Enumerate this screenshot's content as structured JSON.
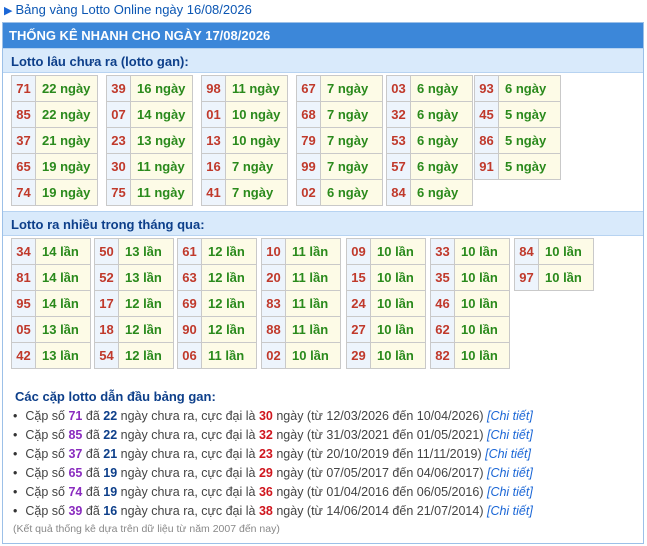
{
  "top_link": "Bảng vàng Lotto Online ngày 16/08/2026",
  "header_title": "THỐNG KÊ NHANH CHO NGÀY 17/08/2026",
  "gan_section": {
    "title": "Lotto lâu chưa ra (lotto gan):",
    "groups": [
      [
        [
          "71",
          "22 ngày"
        ],
        [
          "85",
          "22 ngày"
        ],
        [
          "37",
          "21 ngày"
        ],
        [
          "65",
          "19 ngày"
        ],
        [
          "74",
          "19 ngày"
        ]
      ],
      [
        [
          "39",
          "16 ngày"
        ],
        [
          "07",
          "14 ngày"
        ],
        [
          "23",
          "13 ngày"
        ],
        [
          "30",
          "11 ngày"
        ],
        [
          "75",
          "11 ngày"
        ]
      ],
      [
        [
          "98",
          "11 ngày"
        ],
        [
          "01",
          "10 ngày"
        ],
        [
          "13",
          "10 ngày"
        ],
        [
          "16",
          "7 ngày"
        ],
        [
          "41",
          "7 ngày"
        ]
      ],
      [
        [
          "67",
          "7 ngày"
        ],
        [
          "68",
          "7 ngày"
        ],
        [
          "79",
          "7 ngày"
        ],
        [
          "99",
          "7 ngày"
        ],
        [
          "02",
          "6 ngày"
        ]
      ],
      [
        [
          "03",
          "6 ngày"
        ],
        [
          "32",
          "6 ngày"
        ],
        [
          "53",
          "6 ngày"
        ],
        [
          "57",
          "6 ngày"
        ],
        [
          "84",
          "6 ngày"
        ]
      ],
      [
        [
          "93",
          "6 ngày"
        ],
        [
          "45",
          "5 ngày"
        ],
        [
          "86",
          "5 ngày"
        ],
        [
          "91",
          "5 ngày"
        ]
      ]
    ]
  },
  "most_section": {
    "title": "Lotto ra nhiều trong tháng qua:",
    "groups": [
      [
        [
          "34",
          "14 lần"
        ],
        [
          "81",
          "14 lần"
        ],
        [
          "95",
          "14 lần"
        ],
        [
          "05",
          "13 lần"
        ],
        [
          "42",
          "13 lần"
        ]
      ],
      [
        [
          "50",
          "13 lần"
        ],
        [
          "52",
          "13 lần"
        ],
        [
          "17",
          "12 lần"
        ],
        [
          "18",
          "12 lần"
        ],
        [
          "54",
          "12 lần"
        ]
      ],
      [
        [
          "61",
          "12 lần"
        ],
        [
          "63",
          "12 lần"
        ],
        [
          "69",
          "12 lần"
        ],
        [
          "90",
          "12 lần"
        ],
        [
          "06",
          "11 lần"
        ]
      ],
      [
        [
          "10",
          "11 lần"
        ],
        [
          "20",
          "11 lần"
        ],
        [
          "83",
          "11 lần"
        ],
        [
          "88",
          "11 lần"
        ],
        [
          "02",
          "10 lần"
        ]
      ],
      [
        [
          "09",
          "10 lần"
        ],
        [
          "15",
          "10 lần"
        ],
        [
          "24",
          "10 lần"
        ],
        [
          "27",
          "10 lần"
        ],
        [
          "29",
          "10 lần"
        ]
      ],
      [
        [
          "33",
          "10 lần"
        ],
        [
          "35",
          "10 lần"
        ],
        [
          "46",
          "10 lần"
        ],
        [
          "62",
          "10 lần"
        ],
        [
          "82",
          "10 lần"
        ]
      ],
      [
        [
          "84",
          "10 lần"
        ],
        [
          "97",
          "10 lần"
        ]
      ]
    ]
  },
  "pairs_section": {
    "title": "Các cặp lotto dẫn đầu bảng gan:",
    "text_pair": "Cặp số",
    "text_da": "đã",
    "text_mid": "ngày chưa ra, cực đại là",
    "text_ngay": "ngày",
    "detail_label": "[Chi tiết]",
    "rows": [
      {
        "num": "71",
        "days": "22",
        "max": "30",
        "range": "(từ 12/03/2026 đến 10/04/2026)"
      },
      {
        "num": "85",
        "days": "22",
        "max": "32",
        "range": "(từ 31/03/2021 đến 01/05/2021)"
      },
      {
        "num": "37",
        "days": "21",
        "max": "23",
        "range": "(từ 20/10/2019 đến 11/11/2019)"
      },
      {
        "num": "65",
        "days": "19",
        "max": "29",
        "range": "(từ 07/05/2017 đến 04/06/2017)"
      },
      {
        "num": "74",
        "days": "19",
        "max": "36",
        "range": "(từ 01/04/2016 đến 06/05/2016)"
      },
      {
        "num": "39",
        "days": "16",
        "max": "38",
        "range": "(từ 14/06/2014 đến 21/07/2014)"
      }
    ],
    "footnote": "(Kết quả thống kê dựa trên dữ liệu từ năm 2007 đến nay)"
  },
  "colors": {
    "header_bg": "#3c87d9",
    "section_bg": "#d9eafb",
    "number": "#c0392b",
    "value": "#2a8a1c",
    "max": "#d0161e",
    "link": "#1a66d6"
  }
}
